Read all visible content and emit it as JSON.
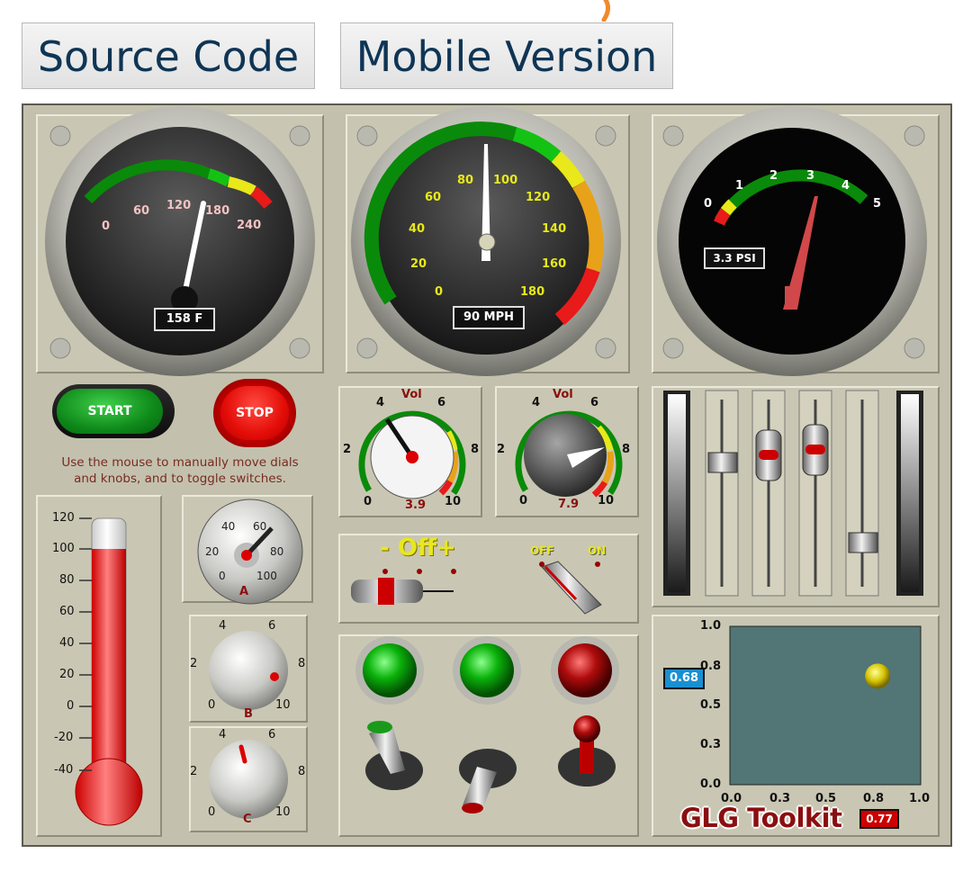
{
  "top_buttons": {
    "source": "Source Code",
    "mobile": "Mobile Version"
  },
  "temp_gauge": {
    "ticks": [
      "0",
      "60",
      "120",
      "180",
      "240"
    ],
    "readout": "158 F",
    "value": 158
  },
  "speed_gauge": {
    "ticks": [
      "0",
      "20",
      "40",
      "60",
      "80",
      "100",
      "120",
      "140",
      "160",
      "180"
    ],
    "readout": "90 MPH",
    "value": 90
  },
  "pressure_gauge": {
    "ticks": [
      "0",
      "1",
      "2",
      "3",
      "4",
      "5"
    ],
    "readout": "3.3 PSI",
    "value": 3.3
  },
  "controls": {
    "start": "START",
    "stop": "STOP",
    "instructions_1": "Use the mouse to manually move dials",
    "instructions_2": "and knobs, and to toggle switches."
  },
  "thermometer": {
    "ticks": [
      "120",
      "100",
      "80",
      "60",
      "40",
      "20",
      "0",
      "-20",
      "-40"
    ],
    "value": 100
  },
  "dial_a": {
    "ticks": [
      "0",
      "20",
      "40",
      "60",
      "80",
      "100"
    ],
    "label": "A"
  },
  "knob_b": {
    "ticks": [
      "0",
      "2",
      "4",
      "6",
      "8",
      "10"
    ],
    "label": "B"
  },
  "knob_c": {
    "ticks": [
      "0",
      "2",
      "4",
      "6",
      "8",
      "10"
    ],
    "label": "C"
  },
  "vol1": {
    "title": "Vol",
    "ticks": [
      "0",
      "2",
      "4",
      "6",
      "8",
      "10"
    ],
    "readout": "3.9"
  },
  "vol2": {
    "title": "Vol",
    "ticks": [
      "0",
      "2",
      "4",
      "6",
      "8",
      "10"
    ],
    "readout": "7.9"
  },
  "switches": {
    "off_plus": "- Off+",
    "off": "OFF",
    "on": "ON"
  },
  "xy_plot": {
    "y_ticks": [
      "1.0",
      "0.8",
      "0.5",
      "0.3",
      "0.0"
    ],
    "x_ticks": [
      "0.0",
      "0.3",
      "0.5",
      "0.8",
      "1.0"
    ],
    "y_readout": "0.68",
    "x_readout": "0.77",
    "point_x": 0.77,
    "point_y": 0.68
  },
  "brand": "GLG Toolkit",
  "colors": {
    "panel": "#c3c1ad",
    "needle_red": "#d0484a",
    "label_red": "#8a0f10",
    "plot_bg": "#527576"
  }
}
